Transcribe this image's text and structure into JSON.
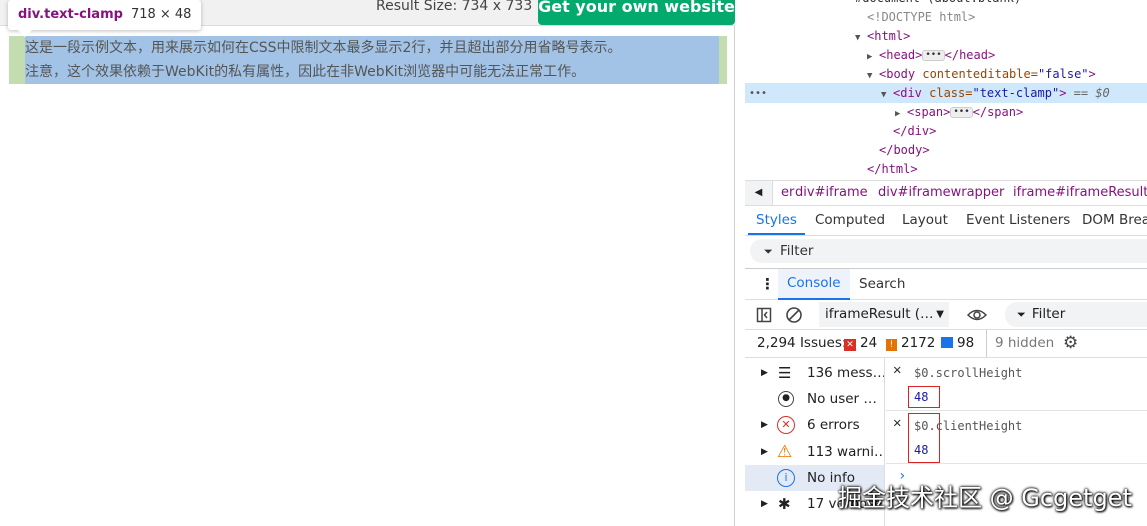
{
  "preview": {
    "result_size": "Result Size: 734 x 733",
    "get_website_button": "Get your own website",
    "tooltip": {
      "selector": "div.text-clamp",
      "dimensions": "718 × 48"
    },
    "clamp_line1": "这是一段示例文本，用来展示如何在CSS中限制文本最多显示2行，并且超出部分用省略号表示。",
    "clamp_line2": "注意，这个效果依赖于WebKit的私有属性，因此在非WebKit浏览器中可能无法正常工作。"
  },
  "dom": {
    "line0": "#document (about:blank)",
    "doctype": "<!DOCTYPE html>",
    "html_open": "<html>",
    "head_open": "<head>",
    "head_close": "</head>",
    "body_tag": "<body",
    "body_attr": " contenteditable=",
    "body_val": "\"false\"",
    "body_end": ">",
    "div_tag": "<div",
    "div_attr": " class=",
    "div_val": "\"text-clamp\"",
    "div_end": ">",
    "div_marker": " == $0",
    "span_open": "<span>",
    "span_close": "</span>",
    "div_close": "</div>",
    "body_close": "</body>",
    "html_close": "</html>",
    "gutter_dots": "•••"
  },
  "breadcrumb": [
    "er",
    "div#iframe",
    "div#iframewrapper",
    "iframe#iframeResult"
  ],
  "elements_tabs": [
    "Styles",
    "Computed",
    "Layout",
    "Event Listeners",
    "DOM Brea"
  ],
  "styles_filter": "Filter",
  "drawer_tabs": [
    "Console",
    "Search"
  ],
  "console_toolbar": {
    "context": "iframeResult (…",
    "filter": "Filter"
  },
  "issues": {
    "label": "2,294 Issues:",
    "errors": "24",
    "warnings": "2172",
    "info": "98",
    "hidden": "9 hidden"
  },
  "sidebar": [
    {
      "label": "136 mess…",
      "icon": "list-icon"
    },
    {
      "label": "No user …",
      "icon": "user-icon"
    },
    {
      "label": "6 errors",
      "icon": "error-icon"
    },
    {
      "label": "113 warni…",
      "icon": "warning-icon"
    },
    {
      "label": "No info",
      "icon": "info-icon"
    },
    {
      "label": "17 verbose",
      "icon": "bug-icon"
    }
  ],
  "console_output": [
    {
      "expr": "$0.scrollHeight",
      "result": "48"
    },
    {
      "expr": "$0.clientHeight",
      "result": "48"
    }
  ],
  "prompt_symbol": "›",
  "watermark": "掘金技术社区 @ Gcgetget",
  "colors": {
    "accent": "#1a73e8",
    "brand_green": "#04aa6d",
    "tag": "#881280",
    "error": "#d93025"
  }
}
